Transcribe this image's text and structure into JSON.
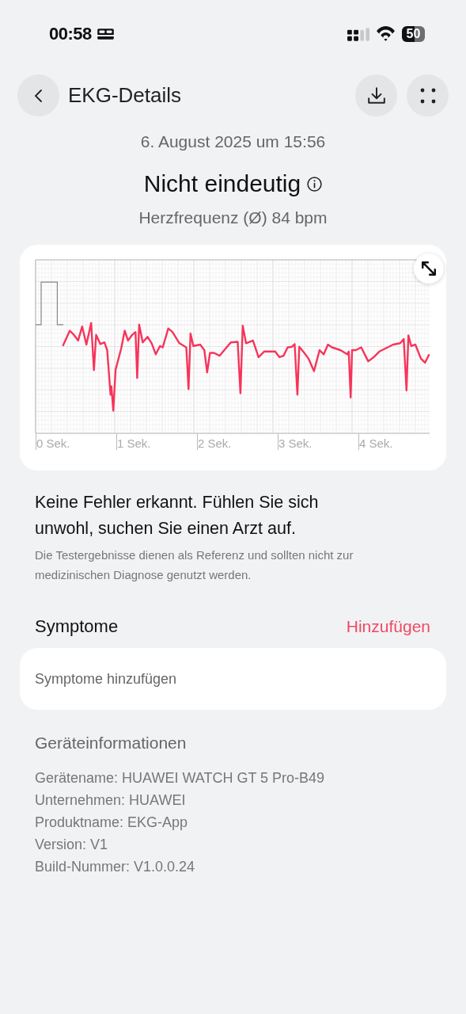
{
  "status_bar": {
    "time": "00:58",
    "battery": "50"
  },
  "header": {
    "title": "EKG-Details"
  },
  "date": "6. August 2025 um 15:56",
  "result": {
    "title": "Nicht eindeutig",
    "heart_rate": "Herzfrequenz (Ø) 84 bpm"
  },
  "ecg": {
    "time_labels": [
      "0 Sek.",
      "1 Sek.",
      "2 Sek.",
      "3 Sek.",
      "4 Sek."
    ]
  },
  "message": "Keine Fehler erkannt. Fühlen Sie sich unwohl, suchen Sie einen Arzt auf.",
  "disclaimer": "Die Testergebnisse dienen als Referenz und sollten nicht zur medizinischen Diagnose genutzt werden.",
  "symptoms": {
    "title": "Symptome",
    "action": "Hinzufügen",
    "placeholder": "Symptome hinzufügen"
  },
  "device_info": {
    "title": "Geräteinformationen",
    "lines": [
      "Gerätename: HUAWEI WATCH GT 5 Pro-B49",
      "Unternehmen: HUAWEI",
      "Produktname: EKG-App",
      "Version: V1",
      "Build-Nummer: V1.0.0.24"
    ]
  }
}
